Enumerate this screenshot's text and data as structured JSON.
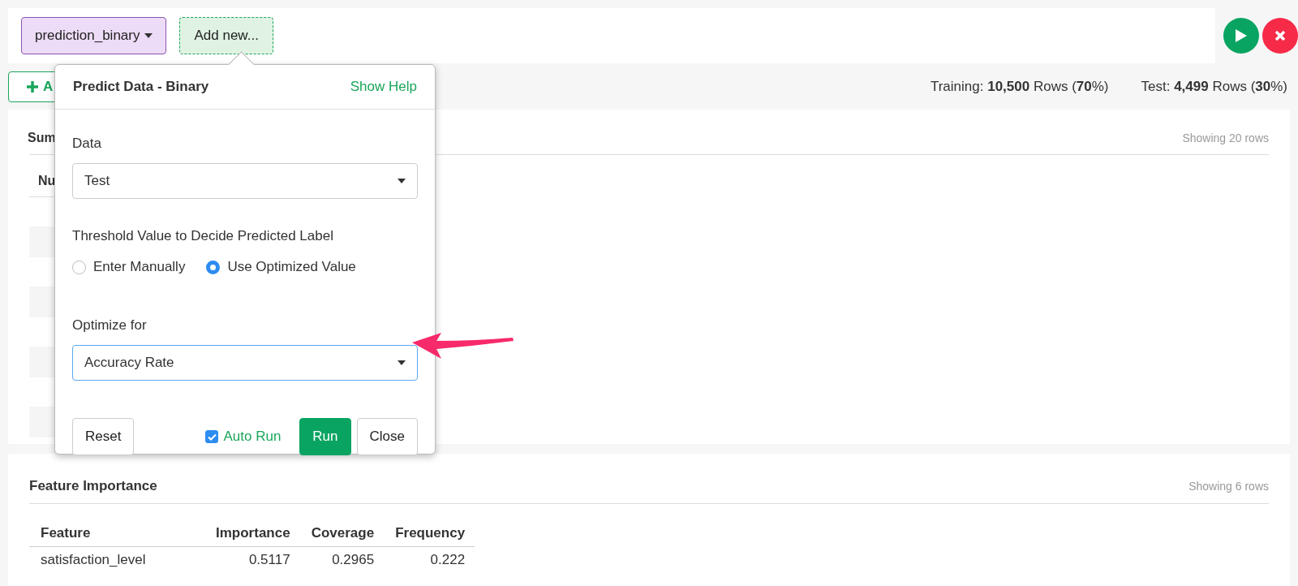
{
  "toolbar": {
    "model_tab": "prediction_binary",
    "add_button": "Add new..."
  },
  "split_bar": {
    "add_button": "A",
    "training": "Training: **10,500** Rows (**70**%)",
    "test": "Test: **4,499** Rows (**30**%)"
  },
  "summary": {
    "title": "Sum",
    "showing": "Showing 20 rows",
    "column_1": "Nu"
  },
  "feature_importance": {
    "title": "Feature Importance",
    "showing": "Showing 6 rows",
    "columns": [
      "Feature",
      "Importance",
      "Coverage",
      "Frequency"
    ],
    "rows": [
      [
        "satisfaction_level",
        "0.5117",
        "0.2965",
        "0.222"
      ]
    ]
  },
  "popover": {
    "title": "Predict Data - Binary",
    "help_link": "Show Help",
    "data_label": "Data",
    "data_value": "Test",
    "threshold_label": "Threshold Value to Decide Predicted Label",
    "radios": [
      {
        "label": "Enter Manually",
        "selected": false
      },
      {
        "label": "Use Optimized Value",
        "selected": true
      }
    ],
    "optimize_label": "Optimize for",
    "optimize_value": "Accuracy Rate",
    "reset": "Reset",
    "auto_run": {
      "label": "Auto Run",
      "checked": true
    },
    "run": "Run",
    "close": "Close"
  }
}
